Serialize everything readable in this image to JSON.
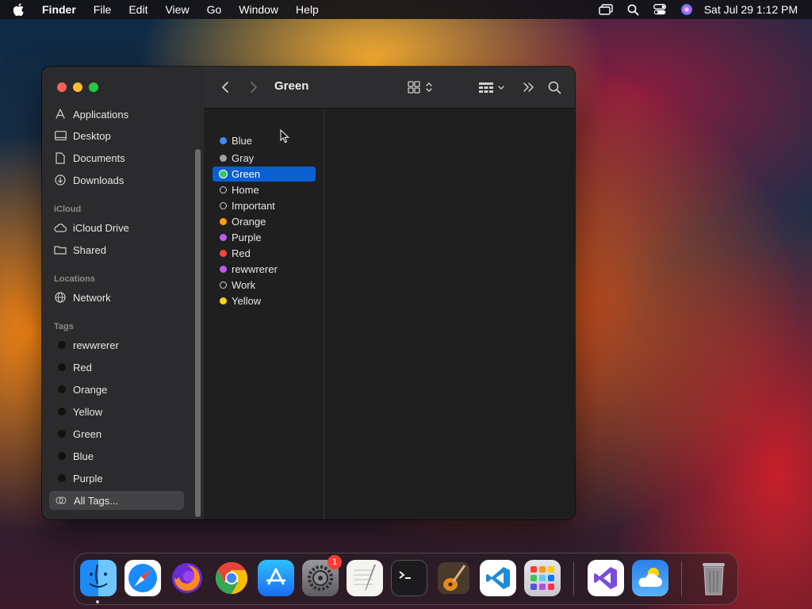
{
  "menubar": {
    "app_name": "Finder",
    "menus": [
      "File",
      "Edit",
      "View",
      "Go",
      "Window",
      "Help"
    ],
    "clock": "Sat Jul 29  1:12 PM"
  },
  "window": {
    "title": "Green",
    "sidebar": {
      "favorites": [
        {
          "label": "Applications",
          "icon": "applications-icon"
        },
        {
          "label": "Desktop",
          "icon": "desktop-icon"
        },
        {
          "label": "Documents",
          "icon": "document-icon"
        },
        {
          "label": "Downloads",
          "icon": "downloads-icon"
        }
      ],
      "icloud_header": "iCloud",
      "icloud": [
        {
          "label": "iCloud Drive",
          "icon": "cloud-icon"
        },
        {
          "label": "Shared",
          "icon": "shared-folder-icon"
        }
      ],
      "locations_header": "Locations",
      "locations": [
        {
          "label": "Network",
          "icon": "globe-icon"
        }
      ],
      "tags_header": "Tags",
      "tags": [
        "rewwrerer",
        "Red",
        "Orange",
        "Yellow",
        "Green",
        "Blue",
        "Purple"
      ],
      "all_tags": "All Tags..."
    },
    "tag_list": [
      {
        "label": "Blue",
        "color": "#3a8ef6"
      },
      {
        "label": "Gray",
        "color": "#a0a0a5"
      },
      {
        "label": "Green",
        "color": "#34c759",
        "selected": true
      },
      {
        "label": "Home",
        "color": ""
      },
      {
        "label": "Important",
        "color": ""
      },
      {
        "label": "Orange",
        "color": "#ff9f0a"
      },
      {
        "label": "Purple",
        "color": "#bf5af2"
      },
      {
        "label": "Red",
        "color": "#ff453a"
      },
      {
        "label": "rewwrerer",
        "color": "#bf5af2"
      },
      {
        "label": "Work",
        "color": ""
      },
      {
        "label": "Yellow",
        "color": "#ffd60a"
      }
    ]
  },
  "dock": {
    "apps": [
      "Finder",
      "Safari",
      "Firefox",
      "Chrome",
      "App Store",
      "System Settings",
      "TextEdit",
      "Terminal",
      "GarageBand",
      "Visual Studio Code",
      "Launchpad",
      "Visual Studio",
      "Weather",
      "Trash"
    ],
    "settings_badge": "1"
  },
  "colors": {
    "selection": "#0a5fd2",
    "sidebar_bg": "#2b2a2c",
    "close": "#ff5f57",
    "minimize": "#febc2e",
    "maximize": "#28c840"
  }
}
